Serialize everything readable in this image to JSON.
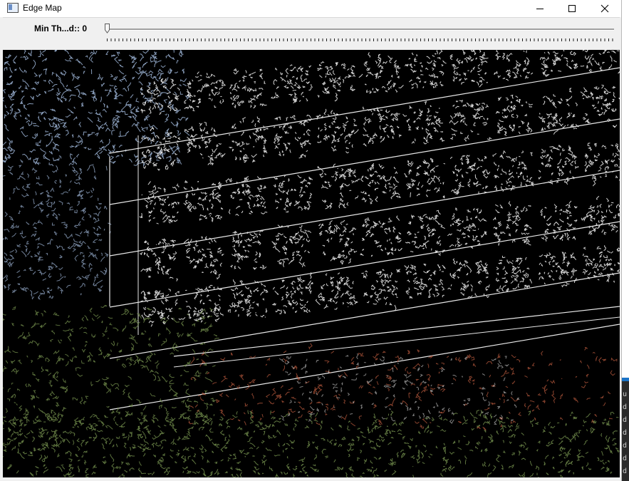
{
  "window": {
    "title": "Edge Map",
    "icon": "app-window-icon",
    "controls": [
      "minimize-icon",
      "maximize-icon",
      "close-icon"
    ]
  },
  "trackbar": {
    "label": "Min Th...d:: 0",
    "value": 0
  },
  "image": {
    "description_type": "canny-edge-map",
    "colors": {
      "background": "#000000",
      "sky_edges": "#9fb6d8",
      "building_edges": "#e8e8e8",
      "foliage_edges": "#6f8a4a",
      "warm_edges": "#b5583c"
    }
  },
  "side_glimpse": {
    "chars": [
      "u",
      "d",
      "d",
      "d",
      "d",
      "d",
      "d",
      "d"
    ]
  }
}
